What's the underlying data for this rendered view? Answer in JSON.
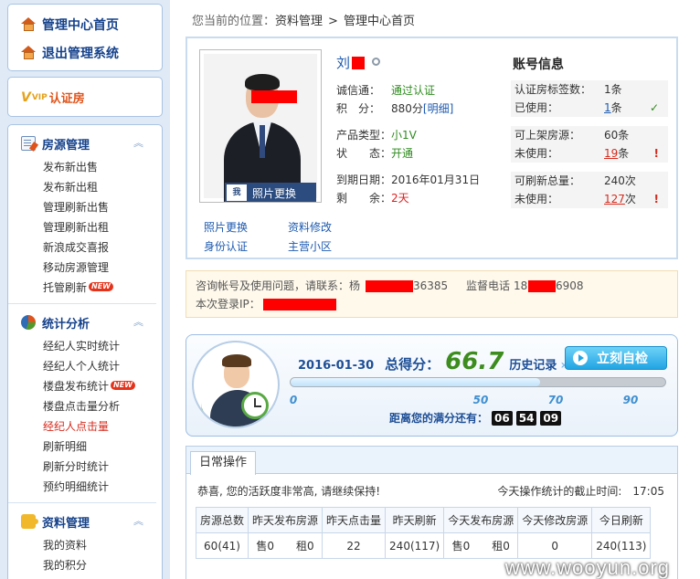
{
  "sidebar": {
    "top_links": [
      "管理中心首页",
      "退出管理系统"
    ],
    "vip_prefix": "V",
    "vip_small": "VIP",
    "vip_label": "认证房",
    "sections": [
      {
        "title": "房源管理",
        "items": [
          "发布新出售",
          "发布新出租",
          "管理刷新出售",
          "管理刷新出租",
          "新浪成交喜报",
          "移动房源管理",
          "托管刷新"
        ]
      },
      {
        "title": "统计分析",
        "items": [
          "经纪人实时统计",
          "经纪人个人统计",
          "楼盘发布统计",
          "楼盘点击量分析",
          "经纪人点击量",
          "刷新明细",
          "刷新分时统计",
          "预约明细统计"
        ]
      },
      {
        "title": "资料管理",
        "items": [
          "我的资料",
          "我的积分"
        ]
      }
    ],
    "new_badge": "NEW",
    "fold_icon": "︽"
  },
  "breadcrumb": {
    "label": "您当前的位置：",
    "items": [
      "资料管理",
      "管理中心首页"
    ],
    "sep": ">"
  },
  "profile": {
    "name": "刘",
    "photo_button": "照片更换",
    "photo_icon_text": "我",
    "links": [
      "照片更换",
      "资料修改",
      "身份认证",
      "主营小区"
    ],
    "rows": [
      {
        "k": "诚信通：",
        "v": "通过认证"
      },
      {
        "k": "积　分：",
        "v": "880分",
        "extra": "[明细]"
      },
      {
        "k": "产品类型：",
        "v": "小1V"
      },
      {
        "k": "状　　态：",
        "v": "开通"
      },
      {
        "k": "到期日期：",
        "v": "2016年01月31日"
      },
      {
        "k": "剩　　余：",
        "v": "2天"
      }
    ]
  },
  "account": {
    "title": "账号信息",
    "groups": [
      [
        {
          "k": "认证房标签数：",
          "v": "1条",
          "mark": ""
        },
        {
          "k": "已使用：",
          "v": "1",
          "unit": "条",
          "mark": "✓"
        }
      ],
      [
        {
          "k": "可上架房源：",
          "v": "60条",
          "mark": ""
        },
        {
          "k": "未使用：",
          "v": "19",
          "unit": "条",
          "mark": "!"
        }
      ],
      [
        {
          "k": "可刷新总量：",
          "v": "240次",
          "mark": ""
        },
        {
          "k": "未使用：",
          "v": "127",
          "unit": "次",
          "mark": "!"
        }
      ]
    ]
  },
  "contact": {
    "line1_label": "咨询帐号及使用问题，请联系：杨",
    "line1_phone_tail": "36385",
    "line1_label2": "监督电话",
    "line1_phone2_head": "18",
    "line1_phone2_tail": "6908",
    "line2_label": "本次登录IP："
  },
  "score": {
    "date": "2016-01-30",
    "label": "总得分：",
    "value": "66.7",
    "history": "历史记录",
    "arrows": "»",
    "check_button": "立刻自检",
    "progress": 0.667,
    "ticks": [
      "0",
      "50",
      "70",
      "90"
    ],
    "tick_values": [
      0,
      50,
      70,
      90
    ],
    "remain_label": "距离您的满分还有：",
    "remain_digits": [
      "06",
      "54",
      "09"
    ]
  },
  "daily": {
    "tab": "日常操作",
    "message": "恭喜, 您的活跃度非常高, 请继续保持!",
    "cutoff": "今天操作统计的截止时间:　17:05",
    "headers": [
      "房源总数",
      "昨天发布房源",
      "昨天点击量",
      "昨天刷新",
      "今天发布房源",
      "今天修改房源",
      "今日刷新"
    ],
    "row": [
      "60(41)",
      "售0　　租0",
      "22",
      "240(117)",
      "售0　　租0",
      "0",
      "240(113)"
    ],
    "watermark": "www.wooyun.org"
  },
  "colors": {
    "accent": "#15428b",
    "link": "#1d5ab0",
    "alert": "#d52b1e",
    "ok": "#2e8b1e",
    "redaction": "#ff0000"
  }
}
